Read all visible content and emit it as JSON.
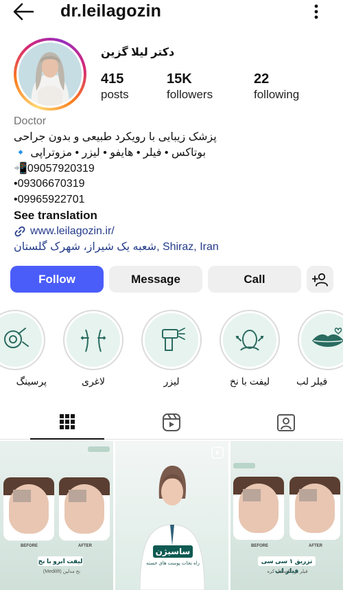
{
  "header": {
    "username": "dr.leilagozin",
    "back_icon": "arrow-left-icon",
    "more_icon": "more-vertical-icon"
  },
  "profile": {
    "full_name": "دکتر لیلا گزین",
    "stats": {
      "posts": {
        "value": "415",
        "label": "posts"
      },
      "followers": {
        "value": "15K",
        "label": "followers"
      },
      "following": {
        "value": "22",
        "label": "following"
      }
    },
    "category": "Doctor",
    "bio_lines": [
      "پزشک زیبایی با رویکرد طبیعی و بدون جراحی",
      "بوتاکس • فیلر • هایفو • لیزر • مزوتراپی 🔹",
      "📲09057920319",
      "•09306670319",
      "•09965922701"
    ],
    "see_translation": "See translation",
    "website": "www.leilagozin.ir/",
    "location": "شعبه یک شیراز، شهرک گلستان, Shiraz, Iran"
  },
  "actions": {
    "follow": "Follow",
    "message": "Message",
    "call": "Call",
    "add_person_icon": "add-person-icon"
  },
  "highlights": [
    {
      "label": "پرسینگ",
      "icon": "piercing-icon"
    },
    {
      "label": "لاغری",
      "icon": "body-slimming-icon"
    },
    {
      "label": "لیزر",
      "icon": "laser-device-icon"
    },
    {
      "label": "لیفت با نخ",
      "icon": "face-lift-icon"
    },
    {
      "label": "فیلر لب",
      "icon": "lips-icon"
    }
  ],
  "tabs": [
    {
      "name": "grid",
      "icon": "grid-icon",
      "active": true
    },
    {
      "name": "reels",
      "icon": "reels-icon",
      "active": false
    },
    {
      "name": "tagged",
      "icon": "tagged-user-icon",
      "active": false
    }
  ],
  "posts": [
    {
      "before": "BEFORE",
      "after": "AFTER",
      "title": "لیفت ابرو با نخ",
      "sub": "نخ مدلین (Medilift)"
    },
    {
      "title": "ساسیژن",
      "sub": "راه نجات پوست های خسته"
    },
    {
      "before": "BEFORE",
      "after": "AFTER",
      "title": "تزریق ۱ سی سی فیلر لب",
      "sub": "فیلر بر تاکستایل کره"
    }
  ],
  "colors": {
    "follow_blue": "#4a5df9",
    "link": "#243b8a",
    "button_grey": "#efefef",
    "highlight_bg": "#e6f3ee"
  }
}
